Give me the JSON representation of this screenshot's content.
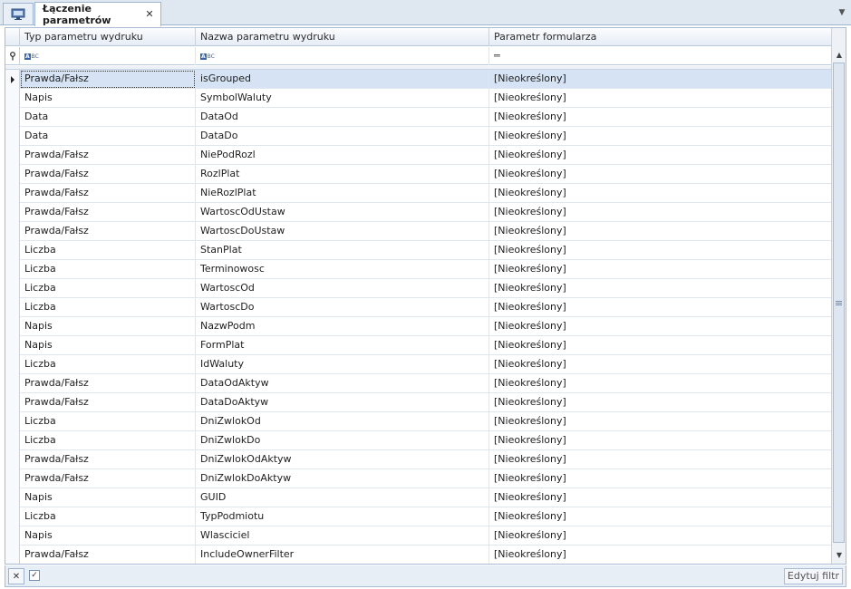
{
  "tabs": {
    "home_icon": "monitor-icon",
    "active_title": "Łączenie parametrów",
    "close_glyph": "✕",
    "menu_glyph": "▼"
  },
  "grid": {
    "columns": [
      "Typ parametru wydruku",
      "Nazwa parametru wydruku",
      "Parametr formularza"
    ],
    "filter_row": {
      "pin_icon": "pin-icon",
      "col1_icon": "abc-filter-icon",
      "col2_icon": "abc-filter-icon",
      "col3_icon": "equals-filter-icon"
    },
    "rows": [
      [
        "Prawda/Fałsz",
        "isGrouped",
        "[Nieokreślony]"
      ],
      [
        "Napis",
        "SymbolWaluty",
        "[Nieokreślony]"
      ],
      [
        "Data",
        "DataOd",
        "[Nieokreślony]"
      ],
      [
        "Data",
        "DataDo",
        "[Nieokreślony]"
      ],
      [
        "Prawda/Fałsz",
        "NiePodRozl",
        "[Nieokreślony]"
      ],
      [
        "Prawda/Fałsz",
        "RozlPlat",
        "[Nieokreślony]"
      ],
      [
        "Prawda/Fałsz",
        "NieRozlPlat",
        "[Nieokreślony]"
      ],
      [
        "Prawda/Fałsz",
        "WartoscOdUstaw",
        "[Nieokreślony]"
      ],
      [
        "Prawda/Fałsz",
        "WartoscDoUstaw",
        "[Nieokreślony]"
      ],
      [
        "Liczba",
        "StanPlat",
        "[Nieokreślony]"
      ],
      [
        "Liczba",
        "Terminowosc",
        "[Nieokreślony]"
      ],
      [
        "Liczba",
        "WartoscOd",
        "[Nieokreślony]"
      ],
      [
        "Liczba",
        "WartoscDo",
        "[Nieokreślony]"
      ],
      [
        "Napis",
        "NazwPodm",
        "[Nieokreślony]"
      ],
      [
        "Napis",
        "FormPlat",
        "[Nieokreślony]"
      ],
      [
        "Liczba",
        "IdWaluty",
        "[Nieokreślony]"
      ],
      [
        "Prawda/Fałsz",
        "DataOdAktyw",
        "[Nieokreślony]"
      ],
      [
        "Prawda/Fałsz",
        "DataDoAktyw",
        "[Nieokreślony]"
      ],
      [
        "Liczba",
        "DniZwlokOd",
        "[Nieokreślony]"
      ],
      [
        "Liczba",
        "DniZwlokDo",
        "[Nieokreślony]"
      ],
      [
        "Prawda/Fałsz",
        "DniZwlokOdAktyw",
        "[Nieokreślony]"
      ],
      [
        "Prawda/Fałsz",
        "DniZwlokDoAktyw",
        "[Nieokreślony]"
      ],
      [
        "Napis",
        "GUID",
        "[Nieokreślony]"
      ],
      [
        "Liczba",
        "TypPodmiotu",
        "[Nieokreślony]"
      ],
      [
        "Napis",
        "Wlasciciel",
        "[Nieokreślony]"
      ],
      [
        "Prawda/Fałsz",
        "IncludeOwnerFilter",
        "[Nieokreślony]"
      ]
    ],
    "selected_row": 0
  },
  "footer": {
    "clear_filter_icon": "clear-filter-icon",
    "filter_enabled": true,
    "edit_filter_label": "Edytuj filtr"
  }
}
